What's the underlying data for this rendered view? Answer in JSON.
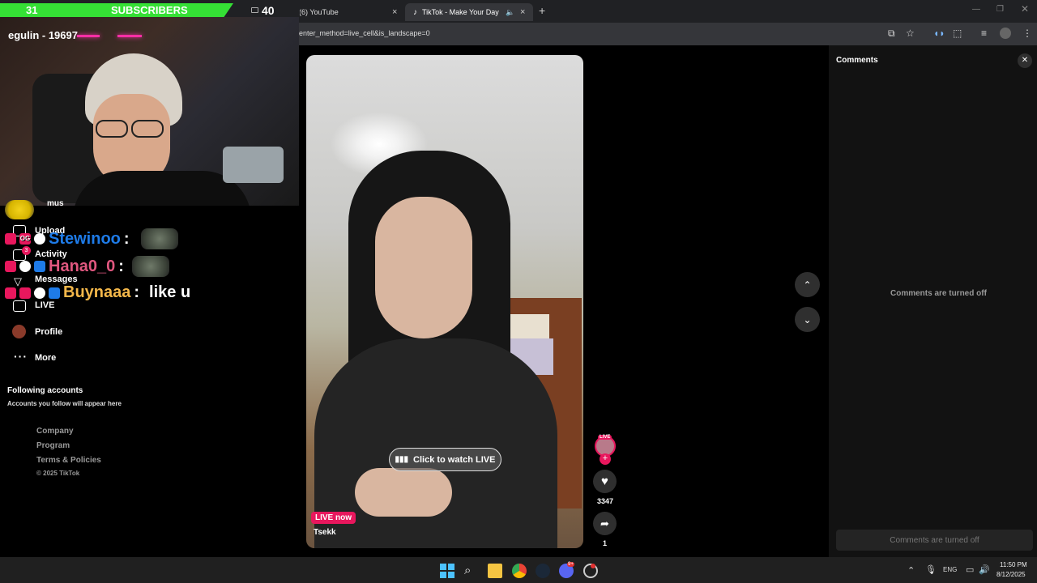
{
  "overlay": {
    "sub_count": "31",
    "sub_label": "SUBSCRIBERS",
    "viewer_count": "40",
    "streamer_tag": "egulin - 19697"
  },
  "browser": {
    "tabs": [
      {
        "title": "(6) YouTube",
        "active": false
      },
      {
        "title": "TikTok - Make Your Day",
        "active": true
      }
    ],
    "url": "enter_method=live_cell&is_landscape=0",
    "new_tab": "+",
    "close": "×"
  },
  "sidebar": {
    "nav": [
      {
        "label": "mus"
      },
      {
        "label": "Upload"
      },
      {
        "label": "Activity",
        "badge": "3"
      },
      {
        "label": "Messages"
      },
      {
        "label": "LIVE"
      },
      {
        "label": "Profile"
      },
      {
        "label": "More"
      }
    ],
    "following_title": "Following accounts",
    "following_sub": "Accounts you follow will appear here",
    "footer": [
      "Company",
      "Program",
      "Terms & Policies",
      "© 2025 TikTok"
    ]
  },
  "chat": [
    {
      "user": "Stewinoo",
      "sep": ":",
      "message": "",
      "color": "#1e7be8"
    },
    {
      "user": "Hana0_0",
      "sep": ":",
      "message": "",
      "color": "#e0577f"
    },
    {
      "user": "Buynaaa",
      "sep": ":",
      "message": "like u",
      "color": "#f5b84a"
    }
  ],
  "video": {
    "cta_label": "Click to watch LIVE",
    "live_badge": "LIVE now",
    "creator": "Tsekk",
    "avatar_live": "LIVE",
    "like_count": "3347",
    "share_count": "1"
  },
  "comments": {
    "title": "Comments",
    "off_message": "Comments are turned off",
    "input_placeholder": "Comments are turned off"
  },
  "taskbar": {
    "lang": "ENG",
    "time": "11:50 PM",
    "date": "8/12/2025",
    "discord_badge": "9+"
  },
  "colors": {
    "tiktok_pink": "#e8175d",
    "overlay_green": "#35e035",
    "neon_pink": "#ff2fa6"
  }
}
